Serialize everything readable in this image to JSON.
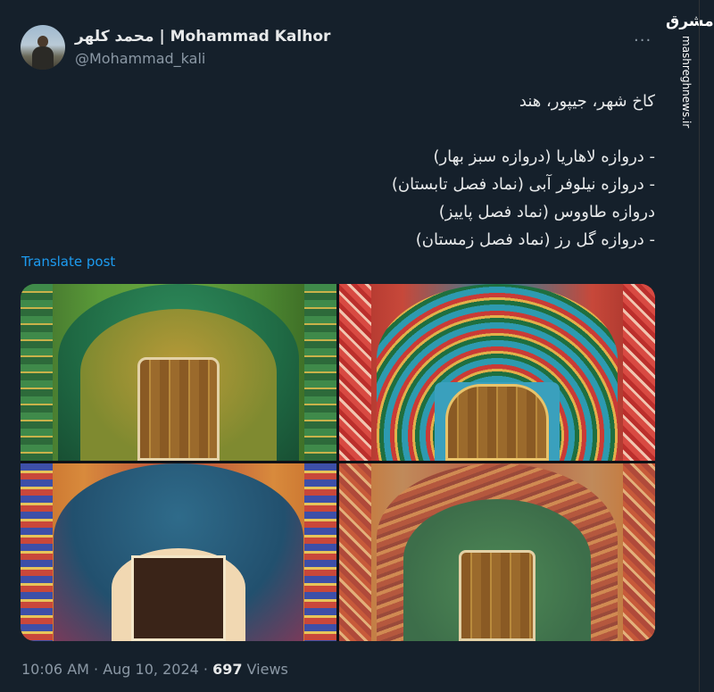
{
  "author": {
    "display_name_fa": "محمد کلهر",
    "display_name_sep": " | ",
    "display_name_en": "Mohammad Kalhor",
    "handle": "@Mohammad_kali"
  },
  "more_label": "...",
  "watermark": {
    "logo": "مشرق",
    "site": "mashreghnews.ir"
  },
  "tweet": {
    "lines": [
      "کاخ شهر، جیپور، هند",
      "",
      "- دروازه لاهاریا (دروازه سبز بهار)",
      "- دروازه نیلوفر آبی (نماد فصل تابستان)",
      "دروازه طاووس (نماد فصل پاییز)",
      "- دروازه گل رز (نماد فصل زمستان)"
    ]
  },
  "translate_label": "Translate post",
  "photos": [
    {
      "name": "green-lehariya-gate"
    },
    {
      "name": "lotus-gate"
    },
    {
      "name": "peacock-gate"
    },
    {
      "name": "rose-gate"
    }
  ],
  "meta": {
    "time": "10:06 AM",
    "dot": " · ",
    "date": "Aug 10, 2024",
    "views_count": "697",
    "views_label": " Views"
  }
}
